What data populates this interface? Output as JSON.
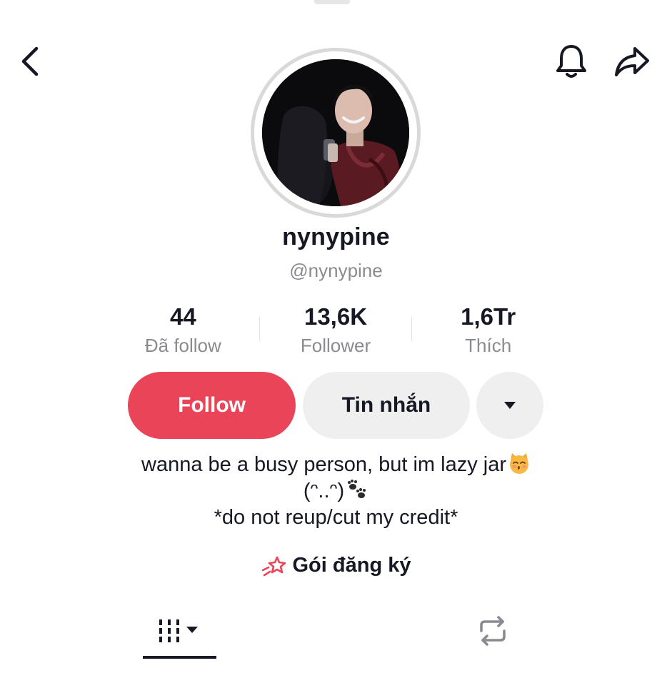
{
  "header": {
    "back_icon": "chevron-left-icon",
    "notification_icon": "bell-icon",
    "share_icon": "share-arrow-icon"
  },
  "profile": {
    "display_name": "nynypine",
    "handle": "@nynypine",
    "avatar_icon": "profile-photo"
  },
  "stats": [
    {
      "value": "44",
      "label": "Đã follow"
    },
    {
      "value": "13,6K",
      "label": "Follower"
    },
    {
      "value": "1,6Tr",
      "label": "Thích"
    }
  ],
  "actions": {
    "follow_label": "Follow",
    "message_label": "Tin nhắn",
    "more_icon": "triangle-down-icon"
  },
  "bio": {
    "line1": "wanna be a busy person, but im lazy jar",
    "line1_emoji": "kissing-cat-emoji",
    "line2": "(ᵔ..ᵔ)",
    "line2_emoji": "paw-prints-emoji",
    "line3": "*do not reup/cut my credit*"
  },
  "subscription": {
    "icon": "shooting-star-icon",
    "label": "Gói đăng ký"
  },
  "tabs": [
    {
      "name": "videos",
      "icon": "grid-bars-icon",
      "selected": true
    },
    {
      "name": "reposts",
      "icon": "repost-icon",
      "selected": false
    }
  ],
  "colors": {
    "accent": "#ea4459",
    "text_primary": "#161823",
    "text_secondary": "#8a8b91",
    "button_bg": "#efefef"
  }
}
